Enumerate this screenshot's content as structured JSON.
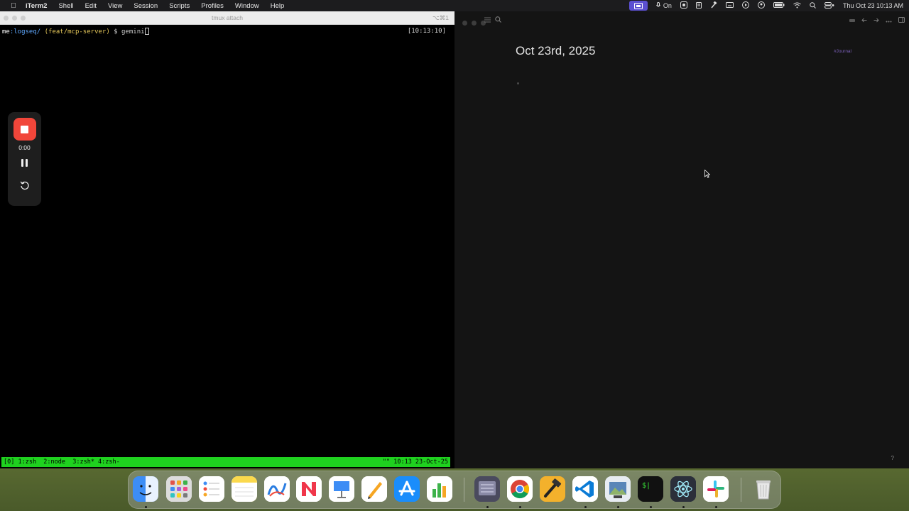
{
  "menubar": {
    "app_name": "iTerm2",
    "menus": [
      "Shell",
      "Edit",
      "View",
      "Session",
      "Scripts",
      "Profiles",
      "Window",
      "Help"
    ],
    "status_on": "On",
    "datetime": "Thu Oct 23  10:13 AM"
  },
  "iterm": {
    "window_title": "tmux attach",
    "shortcut": "⌥⌘1",
    "prompt_user": "me",
    "prompt_path": ":logseq/",
    "prompt_branch": "(feat/mcp-server)",
    "prompt_symbol": "$",
    "command": "gemini",
    "clock": "[10:13:10]",
    "tmux_left": "[0] 1:zsh  2:node  3:zsh* 4:zsh-",
    "tmux_right": "\"\" 10:13 23-Oct-25"
  },
  "recorder": {
    "timer": "0:00"
  },
  "logseq": {
    "page_title": "Oct 23rd, 2025",
    "tag": "#Journal",
    "help": "?"
  },
  "dock": {
    "apps": [
      {
        "name": "Finder",
        "color": "#3d8df5"
      },
      {
        "name": "Launchpad",
        "color": "#e8e8e8"
      },
      {
        "name": "Reminders",
        "color": "#ffffff"
      },
      {
        "name": "Notes",
        "color": "#fbd94d"
      },
      {
        "name": "Freeform",
        "color": "#ffffff"
      },
      {
        "name": "News",
        "color": "#ffffff"
      },
      {
        "name": "Keynote",
        "color": "#ffffff"
      },
      {
        "name": "Pages",
        "color": "#ffffff"
      },
      {
        "name": "App Store",
        "color": "#1a8dfb"
      },
      {
        "name": "Numbers",
        "color": "#ffffff"
      },
      {
        "name": "Simulator",
        "color": "#5a5a6e"
      },
      {
        "name": "Chrome",
        "color": "#ffffff"
      },
      {
        "name": "Xcode Tool",
        "color": "#f3b12c"
      },
      {
        "name": "VS Code",
        "color": "#ffffff"
      },
      {
        "name": "Preview",
        "color": "#dfe6ee"
      },
      {
        "name": "Terminal",
        "color": "#111111"
      },
      {
        "name": "Electron",
        "color": "#2b2f3a"
      },
      {
        "name": "Slack",
        "color": "#ffffff"
      },
      {
        "name": "Trash",
        "color": "#d8d8d8"
      }
    ]
  }
}
